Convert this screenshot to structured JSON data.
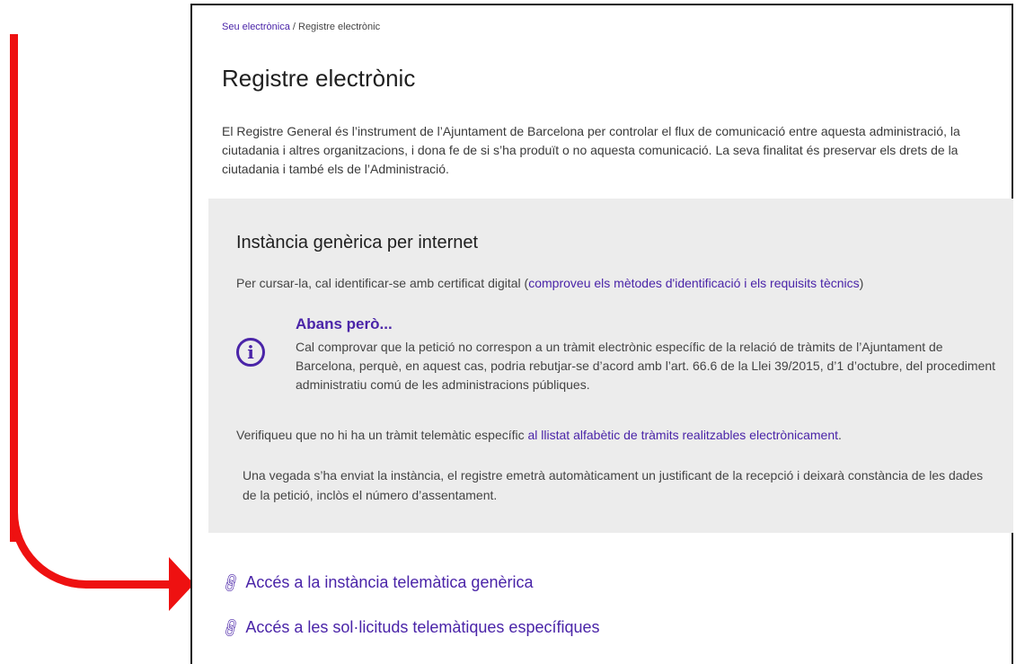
{
  "breadcrumb": {
    "home": "Seu electrònica",
    "separator": " / ",
    "current": "Registre electrònic"
  },
  "page": {
    "title": "Registre electrònic",
    "intro": "El Registre General és l’instrument de l’Ajuntament de Barcelona per controlar el flux de comunicació entre aquesta administració, la ciutadania i altres organitzacions, i dona fe de si s’ha produït o no aquesta comunicació. La seva finalitat és preservar els drets de la ciutadania i també els de l’Administració."
  },
  "panel": {
    "title": "Instància genèrica per internet",
    "cert_text_before": "Per cursar-la, cal identificar-se amb certificat digital (",
    "cert_link": "comproveu els mètodes d'identificació i els requisits tècnics",
    "cert_text_after": ")",
    "warning_title": "Abans però...",
    "warning_text": "Cal comprovar que la petició no correspon a un tràmit electrònic específic de la relació de tràmits de l’Ajuntament de Barcelona, perquè, en aquest cas, podria rebutjar-se d’acord amb l’art. 66.6 de la Llei 39/2015, d’1 d’octubre, del procediment administratiu comú de les administracions públiques.",
    "verify_text_before": "Verifiqueu que no hi ha un tràmit telemàtic específic ",
    "verify_link": "al llistat alfabètic de tràmits realitzables electrònicament",
    "verify_text_after": ".",
    "receipt_text": "Una vegada s’ha enviat la instància, el registre emetrà automàticament un justificant de la recepció i deixarà constància de les dades de la petició, inclòs el número d’assentament."
  },
  "links": {
    "generic_label": "Accés a la instància telemàtica genèrica",
    "specific_label": "Accés a les sol·licituds telemàtiques específiques"
  },
  "icons": {
    "info": "info-circle-icon",
    "link": "link-chain-icon"
  },
  "colors": {
    "accent": "#4a24a8",
    "annotation": "#ee1111",
    "panel_bg": "#ececec"
  }
}
